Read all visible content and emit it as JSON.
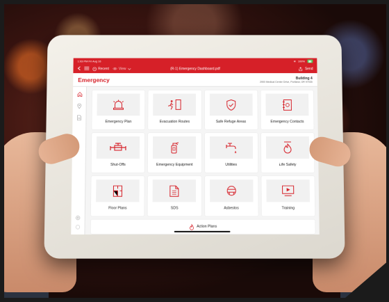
{
  "status_bar": {
    "time": "1:03 PM  Fri Aug 16",
    "wifi": "≋",
    "battery_text": "100%",
    "battery_badge": "▮▮"
  },
  "toolbar": {
    "recent_label": "Recent",
    "view_label": "View",
    "doc_title": "(R-1) Emergency Dashboard.pdf",
    "send_label": "Send"
  },
  "header": {
    "title": "Emergency",
    "building_name": "Building 4",
    "building_address": "2900 Medical Center Drive, Portland, OR 97035"
  },
  "tiles": [
    {
      "label": "Emergency Plan",
      "icon": "siren-icon"
    },
    {
      "label": "Evacuation Routes",
      "icon": "exit-door-icon"
    },
    {
      "label": "Safe Refuge Areas",
      "icon": "shield-check-icon"
    },
    {
      "label": "Emergency Contacts",
      "icon": "contact-book-icon"
    },
    {
      "label": "Shut-Offs",
      "icon": "valve-icon"
    },
    {
      "label": "Emergency Equipment",
      "icon": "fire-extinguisher-icon"
    },
    {
      "label": "Utilities",
      "icon": "faucet-icon"
    },
    {
      "label": "Life Safety",
      "icon": "flame-icon"
    },
    {
      "label": "Floor Plans",
      "icon": "floor-plan-icon"
    },
    {
      "label": "SDS",
      "icon": "document-icon"
    },
    {
      "label": "Asbestos",
      "icon": "respirator-icon"
    },
    {
      "label": "Training",
      "icon": "video-play-icon"
    }
  ],
  "action_plans": {
    "label": "Action Plans",
    "icon": "flame-icon"
  },
  "colors": {
    "brand": "#d62028",
    "battery": "#57c45a"
  }
}
